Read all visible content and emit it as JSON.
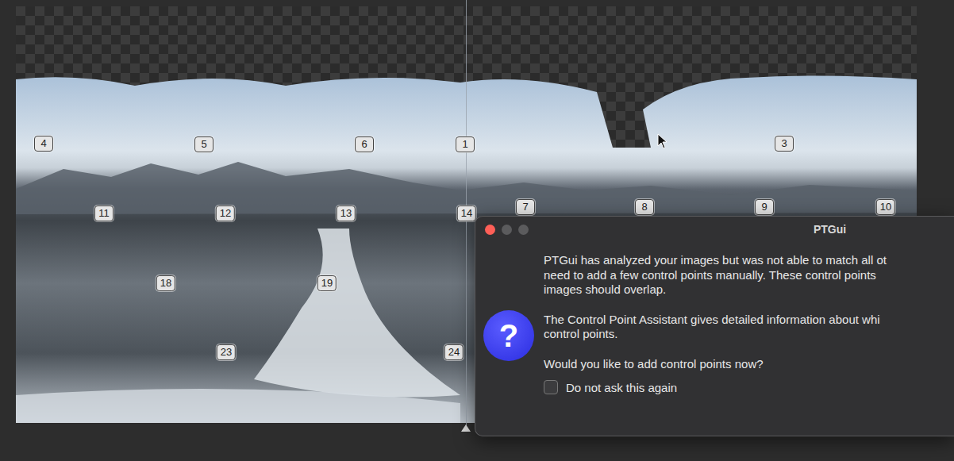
{
  "canvas": {
    "image_labels": [
      {
        "label": "4"
      },
      {
        "label": "5"
      },
      {
        "label": "6"
      },
      {
        "label": "1"
      },
      {
        "label": "3"
      },
      {
        "label": "11"
      },
      {
        "label": "12"
      },
      {
        "label": "13"
      },
      {
        "label": "14"
      },
      {
        "label": "7"
      },
      {
        "label": "8"
      },
      {
        "label": "9"
      },
      {
        "label": "10"
      },
      {
        "label": "18"
      },
      {
        "label": "19"
      },
      {
        "label": "23"
      },
      {
        "label": "24"
      }
    ]
  },
  "dialog": {
    "title": "PTGui",
    "icon": "?",
    "paragraphs": [
      [
        "PTGui has analyzed your images but was not able to match all ot",
        "need to add a few control points manually. These control points",
        "images should overlap."
      ],
      [
        "The Control Point Assistant gives detailed information about whi",
        "control points."
      ],
      [
        "Would you like to add control points now?"
      ]
    ],
    "checkbox": {
      "label": "Do not ask this again",
      "checked": false
    }
  }
}
